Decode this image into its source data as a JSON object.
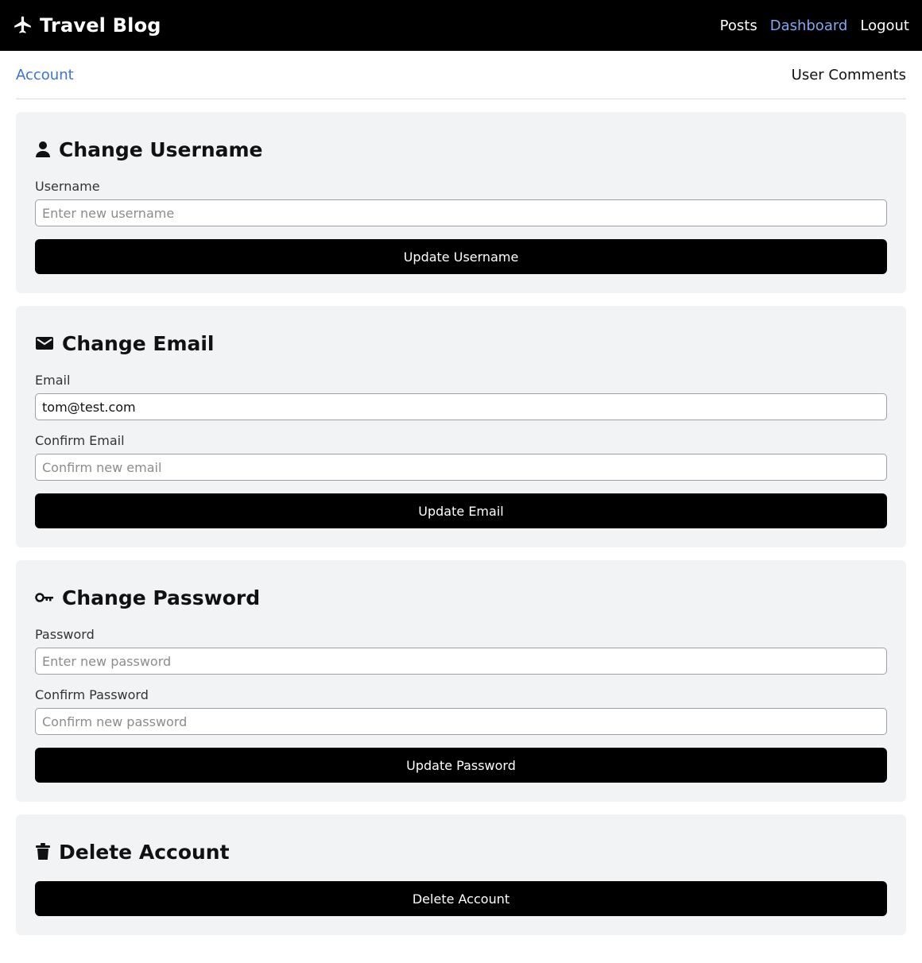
{
  "header": {
    "brand": "Travel Blog",
    "brand_icon": "airplane-icon",
    "nav": {
      "posts": "Posts",
      "dashboard": "Dashboard",
      "logout": "Logout"
    }
  },
  "subnav": {
    "account": "Account",
    "user_comments": "User Comments"
  },
  "username_card": {
    "icon": "user-icon",
    "title": "Change Username",
    "label": "Username",
    "placeholder": "Enter new username",
    "button": "Update Username"
  },
  "email_card": {
    "icon": "envelope-icon",
    "title": "Change Email",
    "email_label": "Email",
    "email_value": "tom@test.com",
    "confirm_label": "Confirm Email",
    "confirm_placeholder": "Confirm new email",
    "button": "Update Email"
  },
  "password_card": {
    "icon": "key-icon",
    "title": "Change Password",
    "password_label": "Password",
    "password_placeholder": "Enter new password",
    "confirm_label": "Confirm Password",
    "confirm_placeholder": "Confirm new password",
    "button": "Update Password"
  },
  "delete_card": {
    "icon": "trash-icon",
    "title": "Delete Account",
    "button": "Delete Account"
  },
  "colors": {
    "header_bg": "#000000",
    "active_nav": "#7fa8f0",
    "active_tab": "#3a72d6",
    "card_bg": "#f2f3f5",
    "button_bg": "#000000"
  }
}
